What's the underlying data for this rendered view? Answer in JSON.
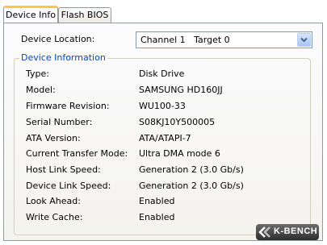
{
  "tabs": [
    {
      "label": "Device Info",
      "active": true
    },
    {
      "label": "Flash BIOS",
      "active": false
    }
  ],
  "device_location": {
    "label": "Device Location:",
    "selected": "Channel 1   Target 0"
  },
  "device_information": {
    "title": "Device Information",
    "rows": [
      {
        "label": "Type:",
        "value": "Disk Drive"
      },
      {
        "label": "Model:",
        "value": "SAMSUNG HD160JJ"
      },
      {
        "label": "Firmware Revision:",
        "value": "WU100-33"
      },
      {
        "label": "Serial Number:",
        "value": "S08KJ10Y500005"
      },
      {
        "label": "ATA Version:",
        "value": "ATA/ATAPI-7"
      },
      {
        "label": "Current Transfer Mode:",
        "value": "Ultra DMA mode 6"
      },
      {
        "label": "Host Link Speed:",
        "value": "Generation 2 (3.0 Gb/s)"
      },
      {
        "label": "Device Link Speed:",
        "value": "Generation 2 (3.0 Gb/s)"
      },
      {
        "label": "Look Ahead:",
        "value": "Enabled"
      },
      {
        "label": "Write Cache:",
        "value": "Enabled"
      }
    ]
  },
  "watermark": {
    "text": "K-BENCH"
  },
  "colors": {
    "tab_highlight": "#ffc83c",
    "group_title": "#0046d5",
    "dropdown_button": "#a8c3f6"
  },
  "icons": {
    "dropdown": "chevron-down-icon",
    "logo": "k-bench-logo"
  }
}
